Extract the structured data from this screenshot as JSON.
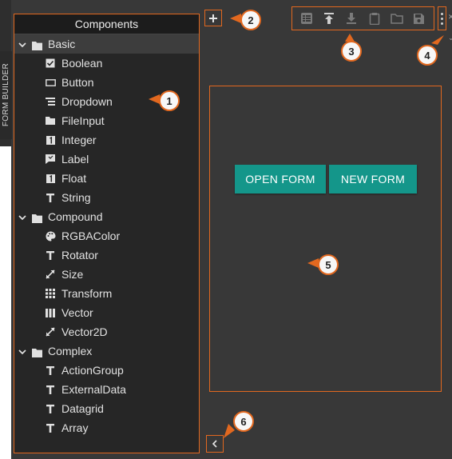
{
  "sidebar_tab": {
    "label": "FORM BUILDER"
  },
  "components": {
    "title": "Components",
    "groups": [
      {
        "label": "Basic",
        "items": [
          {
            "label": "Boolean",
            "icon": "checkbox-icon"
          },
          {
            "label": "Button",
            "icon": "button-icon"
          },
          {
            "label": "Dropdown",
            "icon": "list-icon"
          },
          {
            "label": "FileInput",
            "icon": "folder-icon"
          },
          {
            "label": "Integer",
            "icon": "number-icon"
          },
          {
            "label": "Label",
            "icon": "label-icon"
          },
          {
            "label": "Float",
            "icon": "number-icon"
          },
          {
            "label": "String",
            "icon": "text-icon"
          }
        ]
      },
      {
        "label": "Compound",
        "items": [
          {
            "label": "RGBAColor",
            "icon": "palette-icon"
          },
          {
            "label": "Rotator",
            "icon": "text-icon"
          },
          {
            "label": "Size",
            "icon": "resize-icon"
          },
          {
            "label": "Transform",
            "icon": "grid-icon"
          },
          {
            "label": "Vector",
            "icon": "bars-icon"
          },
          {
            "label": "Vector2D",
            "icon": "resize-icon"
          }
        ]
      },
      {
        "label": "Complex",
        "items": [
          {
            "label": "ActionGroup",
            "icon": "text-icon"
          },
          {
            "label": "ExternalData",
            "icon": "text-icon"
          },
          {
            "label": "Datagrid",
            "icon": "text-icon"
          },
          {
            "label": "Array",
            "icon": "text-icon"
          }
        ]
      }
    ]
  },
  "canvas": {
    "open_label": "OPEN FORM",
    "new_label": "NEW FORM"
  },
  "callouts": [
    "1",
    "2",
    "3",
    "4",
    "5",
    "6"
  ],
  "colors": {
    "accent": "#e2681f",
    "primary_button": "#14968a",
    "panel_bg": "#262626",
    "app_bg": "#383838"
  }
}
